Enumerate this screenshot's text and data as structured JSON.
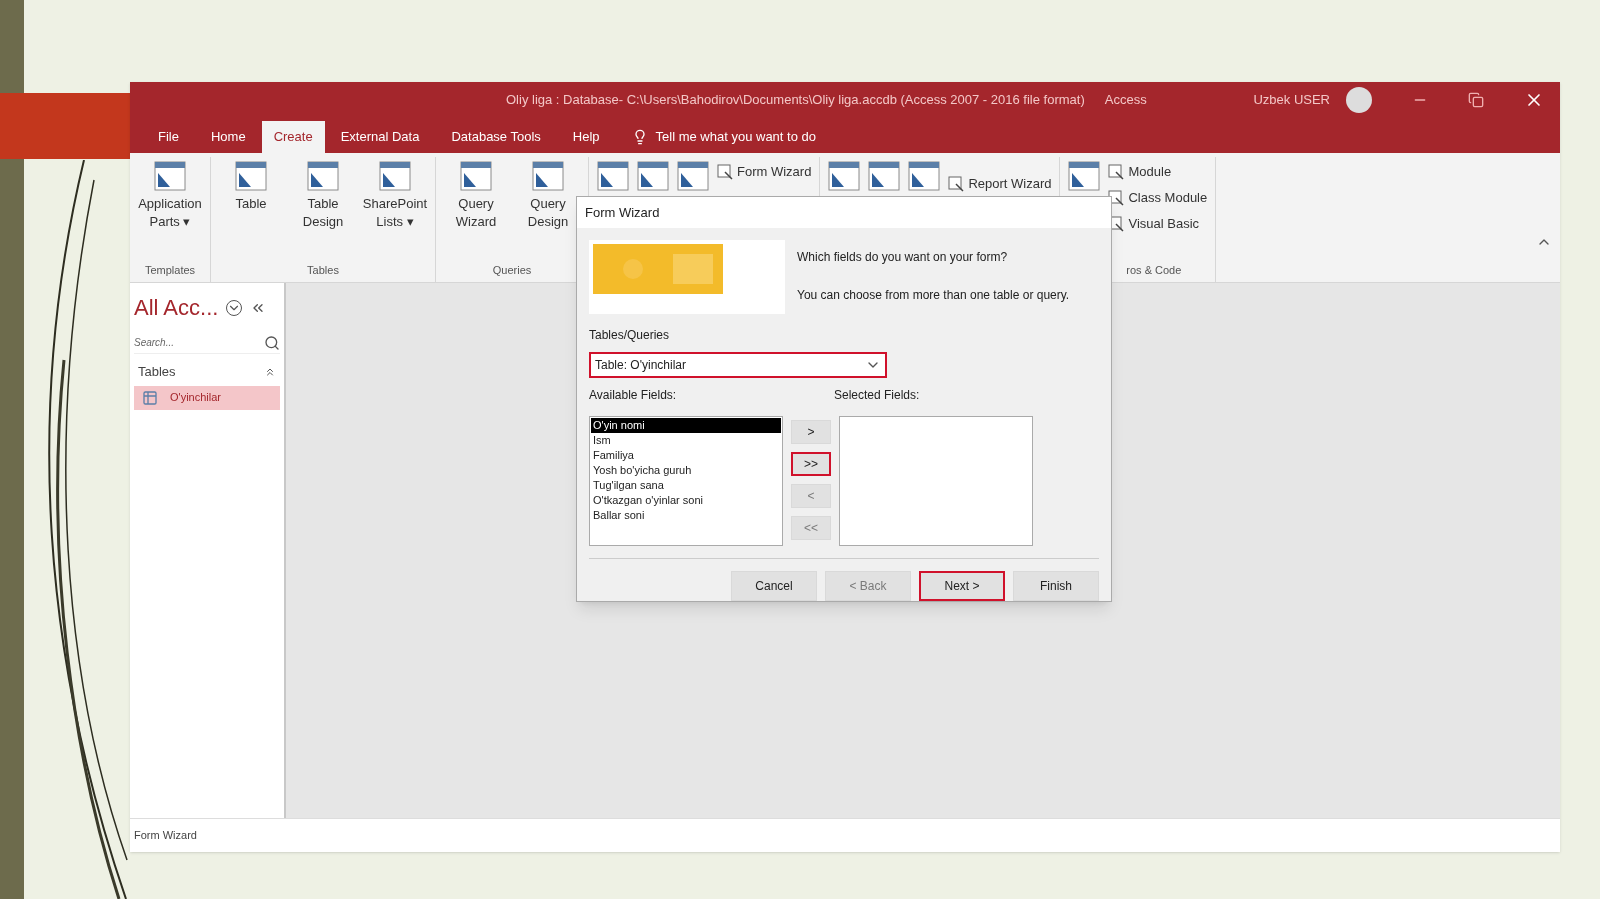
{
  "window": {
    "title": "Oliy liga : Database- C:\\Users\\Bahodirov\\Documents\\Oliy liga.accdb (Access 2007 - 2016 file format)",
    "app_name": "Access",
    "user_name": "Uzbek USER"
  },
  "tabs": [
    {
      "label": "File",
      "selected": false
    },
    {
      "label": "Home",
      "selected": false
    },
    {
      "label": "Create",
      "selected": true
    },
    {
      "label": "External Data",
      "selected": false
    },
    {
      "label": "Database Tools",
      "selected": false
    },
    {
      "label": "Help",
      "selected": false
    }
  ],
  "tell_me": {
    "placeholder": "Tell me what you want to do"
  },
  "ribbon": {
    "groups": [
      {
        "label": "Templates",
        "items": [
          {
            "label": "Application Parts ▾",
            "kind": "large"
          }
        ]
      },
      {
        "label": "Tables",
        "items": [
          {
            "label": "Table",
            "kind": "large"
          },
          {
            "label": "Table Design",
            "kind": "large"
          },
          {
            "label": "SharePoint Lists ▾",
            "kind": "large"
          }
        ]
      },
      {
        "label": "Queries",
        "items": [
          {
            "label": "Query Wizard",
            "kind": "large"
          },
          {
            "label": "Query Design",
            "kind": "large"
          }
        ]
      },
      {
        "items": [
          {
            "label": "Form Wizard",
            "kind": "small"
          }
        ]
      },
      {
        "items": [
          {
            "label": "Report Wizard",
            "kind": "small"
          }
        ]
      },
      {
        "label": "ros & Code",
        "items": [
          {
            "label": "Module",
            "kind": "small"
          },
          {
            "label": "Class Module",
            "kind": "small"
          },
          {
            "label": "Visual Basic",
            "kind": "small"
          }
        ]
      }
    ]
  },
  "nav": {
    "title": "All Acc...",
    "search": {
      "placeholder": "Search..."
    },
    "section": "Tables",
    "items": [
      {
        "label": "O'yinchilar",
        "selected": true
      }
    ]
  },
  "dialog": {
    "title": "Form Wizard",
    "prompt": "Which fields do you want on your form?",
    "hint": "You can choose from more than one table or query.",
    "tables_label": "Tables/Queries",
    "tables_value": "Table: O'yinchilar",
    "tables_annotated": true,
    "available_label": "Available Fields:",
    "selected_label": "Selected Fields:",
    "available_fields": [
      {
        "label": "O'yin nomi",
        "selected": true
      },
      {
        "label": "Ism",
        "selected": false
      },
      {
        "label": "Familiya",
        "selected": false
      },
      {
        "label": "Yosh bo'yicha guruh",
        "selected": false
      },
      {
        "label": "Tug'ilgan sana",
        "selected": false
      },
      {
        "label": "O'tkazgan o'yinlar soni",
        "selected": false
      },
      {
        "label": "Ballar soni",
        "selected": false
      }
    ],
    "move_buttons": [
      {
        "label": ">",
        "disabled": false,
        "annotated": false
      },
      {
        "label": ">>",
        "disabled": false,
        "annotated": true
      },
      {
        "label": "<",
        "disabled": true,
        "annotated": false
      },
      {
        "label": "<<",
        "disabled": true,
        "annotated": false
      }
    ],
    "buttons": [
      {
        "label": "Cancel",
        "disabled": false,
        "annotated": false
      },
      {
        "label": "< Back",
        "disabled": true,
        "annotated": false
      },
      {
        "label": "Next >",
        "disabled": false,
        "annotated": true
      },
      {
        "label": "Finish",
        "disabled": false,
        "annotated": false
      }
    ]
  },
  "status_bar": {
    "text": "Form Wizard"
  }
}
